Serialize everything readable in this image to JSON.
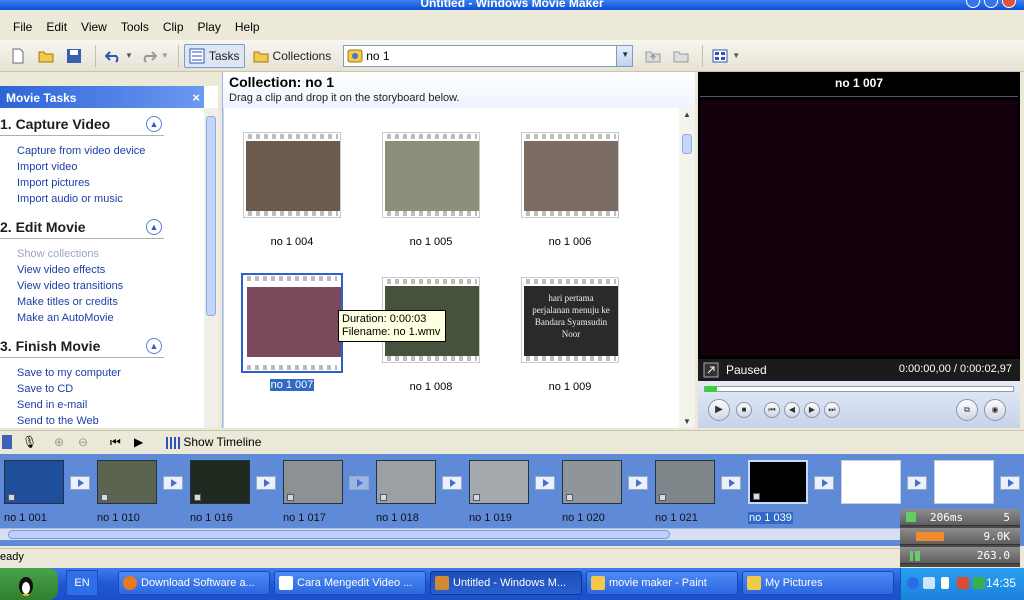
{
  "window": {
    "title": "Untitled - Windows Movie Maker"
  },
  "menu": [
    "File",
    "Edit",
    "View",
    "Tools",
    "Clip",
    "Play",
    "Help"
  ],
  "toolbar": {
    "tasks_label": "Tasks",
    "collections_label": "Collections",
    "collection_value": "no 1"
  },
  "taskpane": {
    "title": "Movie Tasks",
    "close": "×",
    "sections": [
      {
        "title": "1. Capture Video",
        "links": [
          "Capture from video device",
          "Import video",
          "Import pictures",
          "Import audio or music"
        ]
      },
      {
        "title": "2. Edit Movie",
        "links": [
          "Show collections",
          "View video effects",
          "View video transitions",
          "Make titles or credits",
          "Make an AutoMovie"
        ]
      },
      {
        "title": "3. Finish Movie",
        "links": [
          "Save to my computer",
          "Save to CD",
          "Send in e-mail",
          "Send to the Web"
        ]
      }
    ]
  },
  "collection": {
    "title": "Collection: no 1",
    "subtitle": "Drag a clip and drop it on the storyboard below.",
    "clips": [
      {
        "label": "no 1 004",
        "color": "#6b5a4e"
      },
      {
        "label": "no 1 005",
        "color": "#8a8e7a"
      },
      {
        "label": "no 1 006",
        "color": "#7a6c63"
      },
      {
        "label": "no 1 007",
        "color": "#7a4a5c"
      },
      {
        "label": "no 1 008",
        "color": "#46523c"
      },
      {
        "label": "no 1 009",
        "color": "#2a2a2a"
      }
    ],
    "clip009_text": "hari pertama perjalanan menuju ke Bandara Syamsudin Noor",
    "tooltip": {
      "duration": "Duration:  0:00:03",
      "filename": "Filename: no 1.wmv"
    }
  },
  "monitor": {
    "title": "no 1 007",
    "status": "Paused",
    "time": "0:00:00,00 / 0:00:02,97"
  },
  "storyboard": {
    "show_timeline": "Show Timeline",
    "clips": [
      {
        "label": "no 1 001",
        "color": "#1f4f9a"
      },
      {
        "label": "no 1 010",
        "color": "#5a6450"
      },
      {
        "label": "no 1 016",
        "color": "#1d2a1d"
      },
      {
        "label": "no 1 017",
        "color": "#8c9294"
      },
      {
        "label": "no 1 018",
        "color": "#9aa0a4"
      },
      {
        "label": "no 1 019",
        "color": "#a3a9ad"
      },
      {
        "label": "no 1 020",
        "color": "#8f9599"
      },
      {
        "label": "no 1 021",
        "color": "#7f868a"
      },
      {
        "label": "no 1 039",
        "color": "#000000"
      },
      {
        "label": "",
        "color": "#ffffff"
      },
      {
        "label": "",
        "color": "#ffffff"
      }
    ],
    "perf": {
      "latency": "206ms",
      "count": "5",
      "mem": "9.0K",
      "other": "263.0"
    }
  },
  "status": {
    "text": "eady"
  },
  "taskbar": {
    "lang": "EN",
    "tasks": [
      "Download Software a...",
      "Cara Mengedit Video ...",
      "Untitled - Windows M...",
      "movie maker - Paint",
      "My Pictures"
    ],
    "clock": "14:35"
  }
}
